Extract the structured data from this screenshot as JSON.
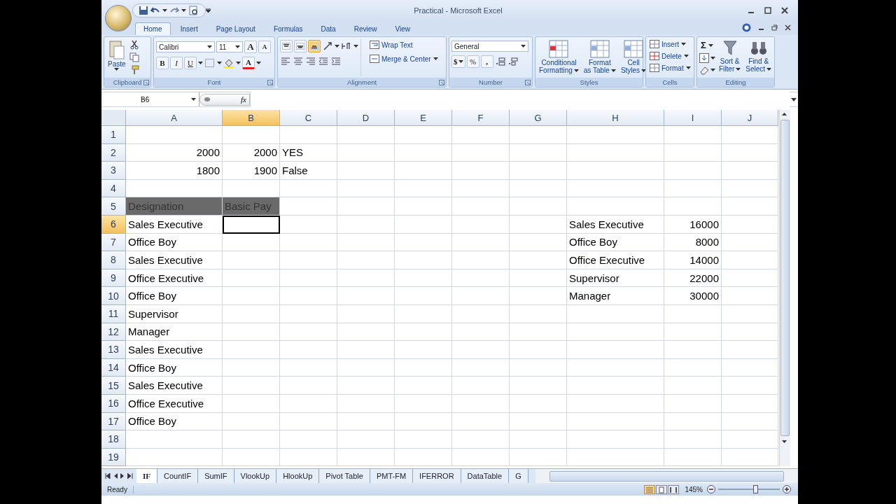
{
  "window": {
    "title": "Practical - Microsoft Excel"
  },
  "ribbon_tabs": [
    {
      "label": "Home",
      "selected": true
    },
    {
      "label": "Insert",
      "selected": false
    },
    {
      "label": "Page Layout",
      "selected": false
    },
    {
      "label": "Formulas",
      "selected": false
    },
    {
      "label": "Data",
      "selected": false
    },
    {
      "label": "Review",
      "selected": false
    },
    {
      "label": "View",
      "selected": false
    }
  ],
  "ribbon": {
    "clipboard": {
      "paste": "Paste",
      "label": "Clipboard"
    },
    "font": {
      "font_name": "Calibri",
      "font_size": "11",
      "size_buttons": [
        "A",
        "A"
      ],
      "format_buttons": [
        "B",
        "I",
        "U"
      ],
      "color_button": "A",
      "label": "Font"
    },
    "alignment": {
      "vertical_align": [
        {
          "selected": false
        },
        {
          "selected": false
        },
        {
          "selected": true
        }
      ],
      "wrap_text": "Wrap Text",
      "merge": "Merge & Center",
      "label": "Alignment"
    },
    "number": {
      "format": "General",
      "buttons": [
        "$",
        "%",
        ","
      ],
      "label": "Number"
    },
    "styles": {
      "buttons": [
        [
          "Conditional",
          "Formatting"
        ],
        [
          "Format",
          "as Table"
        ],
        [
          "Cell",
          "Styles"
        ]
      ],
      "label": "Styles"
    },
    "cells": {
      "buttons": [
        "Insert",
        "Delete",
        "Format"
      ],
      "label": "Cells"
    },
    "editing": {
      "sum": "Σ",
      "buttons": [
        [
          "Sort &",
          "Filter"
        ],
        [
          "Find &",
          "Select"
        ]
      ],
      "label": "Editing"
    }
  },
  "formula_bar": {
    "name_box": "B6",
    "fx": "fx"
  },
  "columns": [
    {
      "label": "A",
      "selected": false
    },
    {
      "label": "B",
      "selected": true
    },
    {
      "label": "C",
      "selected": false
    },
    {
      "label": "D",
      "selected": false
    },
    {
      "label": "E",
      "selected": false
    },
    {
      "label": "F",
      "selected": false
    },
    {
      "label": "G",
      "selected": false
    },
    {
      "label": "H",
      "selected": false
    },
    {
      "label": "I",
      "selected": false
    },
    {
      "label": "J",
      "selected": false
    }
  ],
  "rows": [
    {
      "number": "1",
      "selected": false,
      "filled": false
    },
    {
      "number": "2",
      "selected": false,
      "filled": false,
      "cells": {
        "A": "2000",
        "B": "2000",
        "C": "YES"
      }
    },
    {
      "number": "3",
      "selected": false,
      "filled": false,
      "cells": {
        "A": "1800",
        "B": "1900",
        "C": "False"
      }
    },
    {
      "number": "4",
      "selected": false,
      "filled": false
    },
    {
      "number": "5",
      "selected": false,
      "filled": true,
      "cells": {
        "A": "Designation",
        "B": "Basic Pay"
      }
    },
    {
      "number": "6",
      "selected": true,
      "filled": false,
      "cells": {
        "A": "Sales Executive",
        "H": "Sales Executive",
        "I": "16000"
      }
    },
    {
      "number": "7",
      "selected": false,
      "filled": false,
      "cells": {
        "A": "Office Boy",
        "H": "Office Boy",
        "I": "8000"
      }
    },
    {
      "number": "8",
      "selected": false,
      "filled": false,
      "cells": {
        "A": "Sales Executive",
        "H": "Office Executive",
        "I": "14000"
      }
    },
    {
      "number": "9",
      "selected": false,
      "filled": false,
      "cells": {
        "A": "Office Executive",
        "H": "Supervisor",
        "I": "22000"
      }
    },
    {
      "number": "10",
      "selected": false,
      "filled": false,
      "cells": {
        "A": "Office Boy",
        "H": "Manager",
        "I": "30000"
      }
    },
    {
      "number": "11",
      "selected": false,
      "filled": false,
      "cells": {
        "A": "Supervisor"
      }
    },
    {
      "number": "12",
      "selected": false,
      "filled": false,
      "cells": {
        "A": "Manager"
      }
    },
    {
      "number": "13",
      "selected": false,
      "filled": false,
      "cells": {
        "A": "Sales Executive"
      }
    },
    {
      "number": "14",
      "selected": false,
      "filled": false,
      "cells": {
        "A": "Office Boy"
      }
    },
    {
      "number": "15",
      "selected": false,
      "filled": false,
      "cells": {
        "A": "Sales Executive"
      }
    },
    {
      "number": "16",
      "selected": false,
      "filled": false,
      "cells": {
        "A": "Office Executive"
      }
    },
    {
      "number": "17",
      "selected": false,
      "filled": false,
      "cells": {
        "A": "Office Boy"
      }
    },
    {
      "number": "18",
      "selected": false,
      "filled": false
    },
    {
      "number": "19",
      "selected": false,
      "filled": false
    }
  ],
  "sheet_tabs": [
    {
      "label": "IF",
      "selected": true
    },
    {
      "label": "CountIF",
      "selected": false
    },
    {
      "label": "SumIF",
      "selected": false
    },
    {
      "label": "VlookUp",
      "selected": false
    },
    {
      "label": "HlookUp",
      "selected": false
    },
    {
      "label": "Pivot Table",
      "selected": false
    },
    {
      "label": "PMT-FM",
      "selected": false
    },
    {
      "label": "IFERROR",
      "selected": false
    },
    {
      "label": "DataTable",
      "selected": false
    },
    {
      "label": "G",
      "selected": false
    }
  ],
  "status_bar": {
    "status": "Ready",
    "zoom": "145%",
    "zoom_slider": {
      "level": 0.6
    }
  }
}
